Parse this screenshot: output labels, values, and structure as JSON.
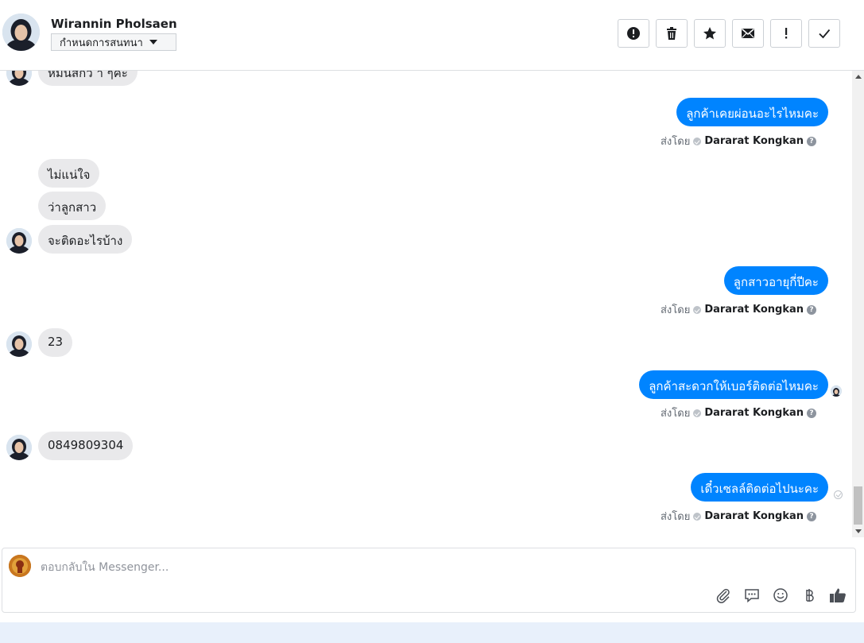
{
  "header": {
    "contact_name": "Wirannin Pholsaen",
    "assign_label": "กำหนดการสนทนา",
    "actions": [
      {
        "name": "spam-button",
        "icon": "alert-circle-icon"
      },
      {
        "name": "delete-button",
        "icon": "trash-icon"
      },
      {
        "name": "star-button",
        "icon": "star-icon"
      },
      {
        "name": "mark-unread-button",
        "icon": "envelope-icon"
      },
      {
        "name": "follow-up-button",
        "icon": "exclamation-icon"
      },
      {
        "name": "mark-done-button",
        "icon": "checkmark-icon"
      }
    ]
  },
  "messages": {
    "in_1": "หมันสกว า ๆคะ",
    "out_1": "ลูกค้าเคยผ่อนอะไรไหมคะ",
    "in_2a": "ไม่แน่ใจ",
    "in_2b": "ว่าลูกสาว",
    "in_2c": "จะติดอะไรบ้าง",
    "out_2": "ลูกสาวอายุกี่ปีคะ",
    "in_3": "23",
    "out_3": "ลูกค้าสะดวกให้เบอร์ติดต่อไหมคะ",
    "in_4": "0849809304",
    "out_4": "เดี๋วเซลล์ติดต่อไปนะคะ"
  },
  "sent_by": {
    "prefix": "ส่งโดย",
    "agent": "Dararat Kongkan",
    "help": "?"
  },
  "composer": {
    "placeholder": "ตอบกลับใน Messenger..."
  },
  "colors": {
    "outgoing_bubble": "#0084ff",
    "incoming_bubble": "#e9e9eb"
  }
}
